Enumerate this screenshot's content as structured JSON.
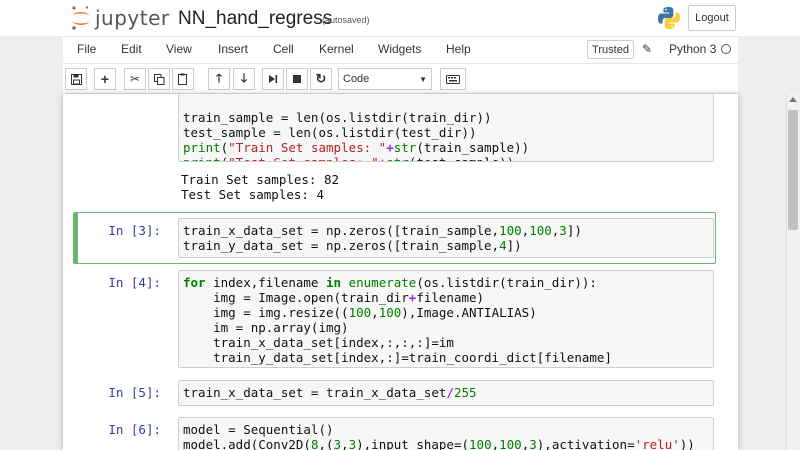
{
  "header": {
    "logo_text": "jupyter",
    "notebook_title": "NN_hand_regress",
    "autosave_status": "(autosaved)",
    "logout_label": "Logout"
  },
  "menubar": {
    "items": [
      "File",
      "Edit",
      "View",
      "Insert",
      "Cell",
      "Kernel",
      "Widgets",
      "Help"
    ],
    "trusted_label": "Trusted",
    "kernel_name": "Python 3"
  },
  "toolbar": {
    "cell_type": "Code",
    "icons": [
      "save-icon",
      "plus-icon",
      "cut-icon",
      "copy-icon",
      "paste-icon",
      "arrow-up-icon",
      "arrow-down-icon",
      "step-forward-icon",
      "stop-icon",
      "restart-icon",
      "keyboard-icon"
    ]
  },
  "cells": [
    {
      "prompt": "",
      "code": [
        "train_sample = len(os.listdir(train_dir))",
        "test_sample = len(os.listdir(test_dir))",
        "print(\"Train Set samples: \"+str(train_sample))",
        "print(\"Test Set samples: \"+str(test_sample))"
      ],
      "output": [
        "Train Set samples: 82",
        "Test Set samples: 4"
      ]
    },
    {
      "prompt": "In [3]:",
      "code": [
        "train_x_data_set = np.zeros([train_sample,100,100,3])",
        "train_y_data_set = np.zeros([train_sample,4])"
      ]
    },
    {
      "prompt": "In [4]:",
      "code": [
        "for index,filename in enumerate(os.listdir(train_dir)):",
        "    img = Image.open(train_dir+filename)",
        "    img = img.resize((100,100),Image.ANTIALIAS)",
        "    im = np.array(img)",
        "    train_x_data_set[index,:,:,:]=im",
        "    train_y_data_set[index,:]=train_coordi_dict[filename]"
      ]
    },
    {
      "prompt": "In [5]:",
      "code": [
        "train_x_data_set = train_x_data_set/255"
      ]
    },
    {
      "prompt": "In [6]:",
      "code": [
        "model = Sequential()",
        "model.add(Conv2D(8,(3,3),input_shape=(100,100,3),activation='relu'))"
      ]
    }
  ],
  "colors": {
    "selected_border": "#66bb6a",
    "prompt_color": "#303f9f",
    "keyword": "#008000",
    "string": "#ba2121",
    "operator": "#aa22ff"
  }
}
